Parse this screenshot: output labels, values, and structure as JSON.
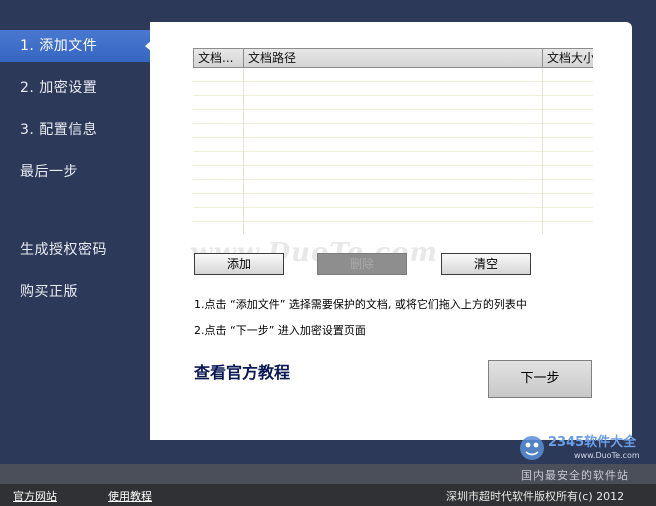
{
  "sidebar": {
    "items": [
      {
        "label": "1. 添加文件"
      },
      {
        "label": "2. 加密设置"
      },
      {
        "label": "3. 配置信息"
      },
      {
        "label": "最后一步"
      },
      {
        "label": "生成授权密码"
      },
      {
        "label": "购买正版"
      }
    ],
    "active_index": 0
  },
  "table": {
    "columns": [
      "文档...",
      "文档路径",
      "文档大小"
    ],
    "rows": []
  },
  "buttons": {
    "add": "添加",
    "delete": "删除",
    "clear": "清空",
    "next": "下一步"
  },
  "instructions": [
    "1.点击 “添加文件” 选择需要保护的文档, 或将它们拖入上方的列表中",
    "2.点击 “下一步” 进入加密设置页面"
  ],
  "tutorial_link": "查看官方教程",
  "watermark": "www.DuoTe.com",
  "brand": {
    "logo_text": "2345软件大全",
    "logo_url_text": "www.DuoTe.com",
    "tagline": "国内最安全的软件站"
  },
  "footer": {
    "official_site": "官方网站",
    "tutorial": "使用教程",
    "copyright": "深圳市超时代软件版权所有(c) 2012"
  },
  "colors": {
    "background": "#2d3958",
    "active_item": "#3a6cc8",
    "panel": "#ffffff",
    "footer": "#303134"
  }
}
